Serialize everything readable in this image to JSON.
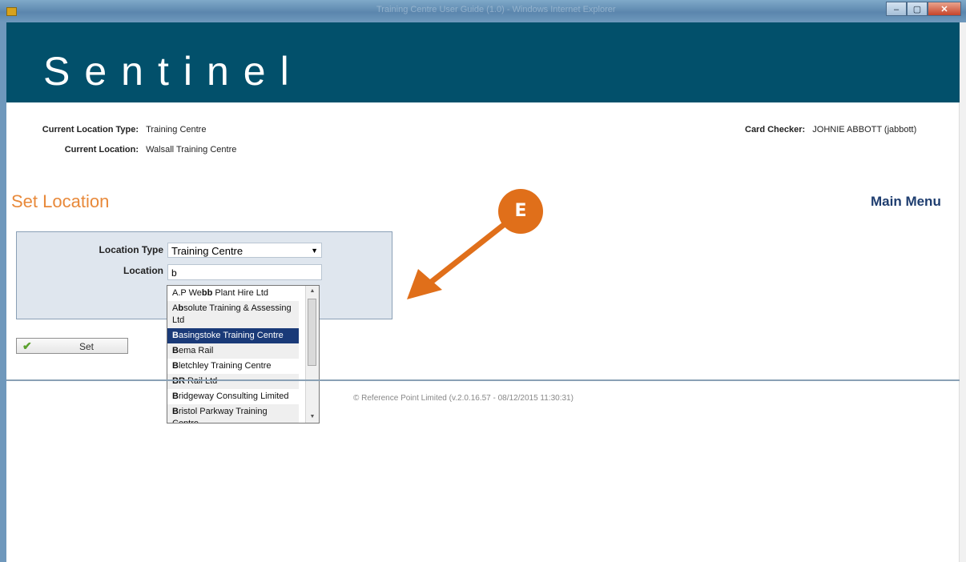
{
  "window": {
    "title": "Training Centre User Guide (1.0) - Windows Internet Explorer",
    "minimize": "–",
    "maximize": "▢",
    "close": "✕"
  },
  "banner": {
    "logo": "Sentinel"
  },
  "info": {
    "location_type_label": "Current Location Type:",
    "location_type_value": "Training Centre",
    "location_label": "Current Location:",
    "location_value": "Walsall Training Centre",
    "card_checker_label": "Card Checker:",
    "card_checker_value": "JOHNIE ABBOTT (jabbott)"
  },
  "page": {
    "heading": "Set Location",
    "main_menu": "Main Menu"
  },
  "form": {
    "location_type_label": "Location Type",
    "location_type_selected": "Training Centre",
    "location_label": "Location",
    "location_value": "b"
  },
  "dropdown": {
    "selected_index": 2,
    "items": [
      {
        "pre": "A.P We",
        "bold": "bb",
        "post": " Plant Hire Ltd"
      },
      {
        "pre": "A",
        "bold": "b",
        "post": "solute Training & Assessing Ltd"
      },
      {
        "pre": "",
        "bold": "B",
        "post": "asingstoke Training Centre"
      },
      {
        "pre": "",
        "bold": "B",
        "post": "ema Rail"
      },
      {
        "pre": "",
        "bold": "B",
        "post": "letchley Training Centre"
      },
      {
        "pre": "",
        "bold": "BR",
        "post": " Rail Ltd"
      },
      {
        "pre": "",
        "bold": "B",
        "post": "ridgeway Consulting Limited"
      },
      {
        "pre": "",
        "bold": "B",
        "post": "ristol Parkway Training Centre"
      }
    ]
  },
  "buttons": {
    "set": "Set"
  },
  "footer": {
    "text": "© Reference Point Limited (v.2.0.16.57 - 08/12/2015 11:30:31)"
  },
  "annotation": {
    "label": "E",
    "color": "#e06f1a"
  },
  "colors": {
    "banner": "#02506b",
    "heading": "#e8893a",
    "main_menu": "#1e3d6f",
    "selected_item": "#1a3a78"
  }
}
